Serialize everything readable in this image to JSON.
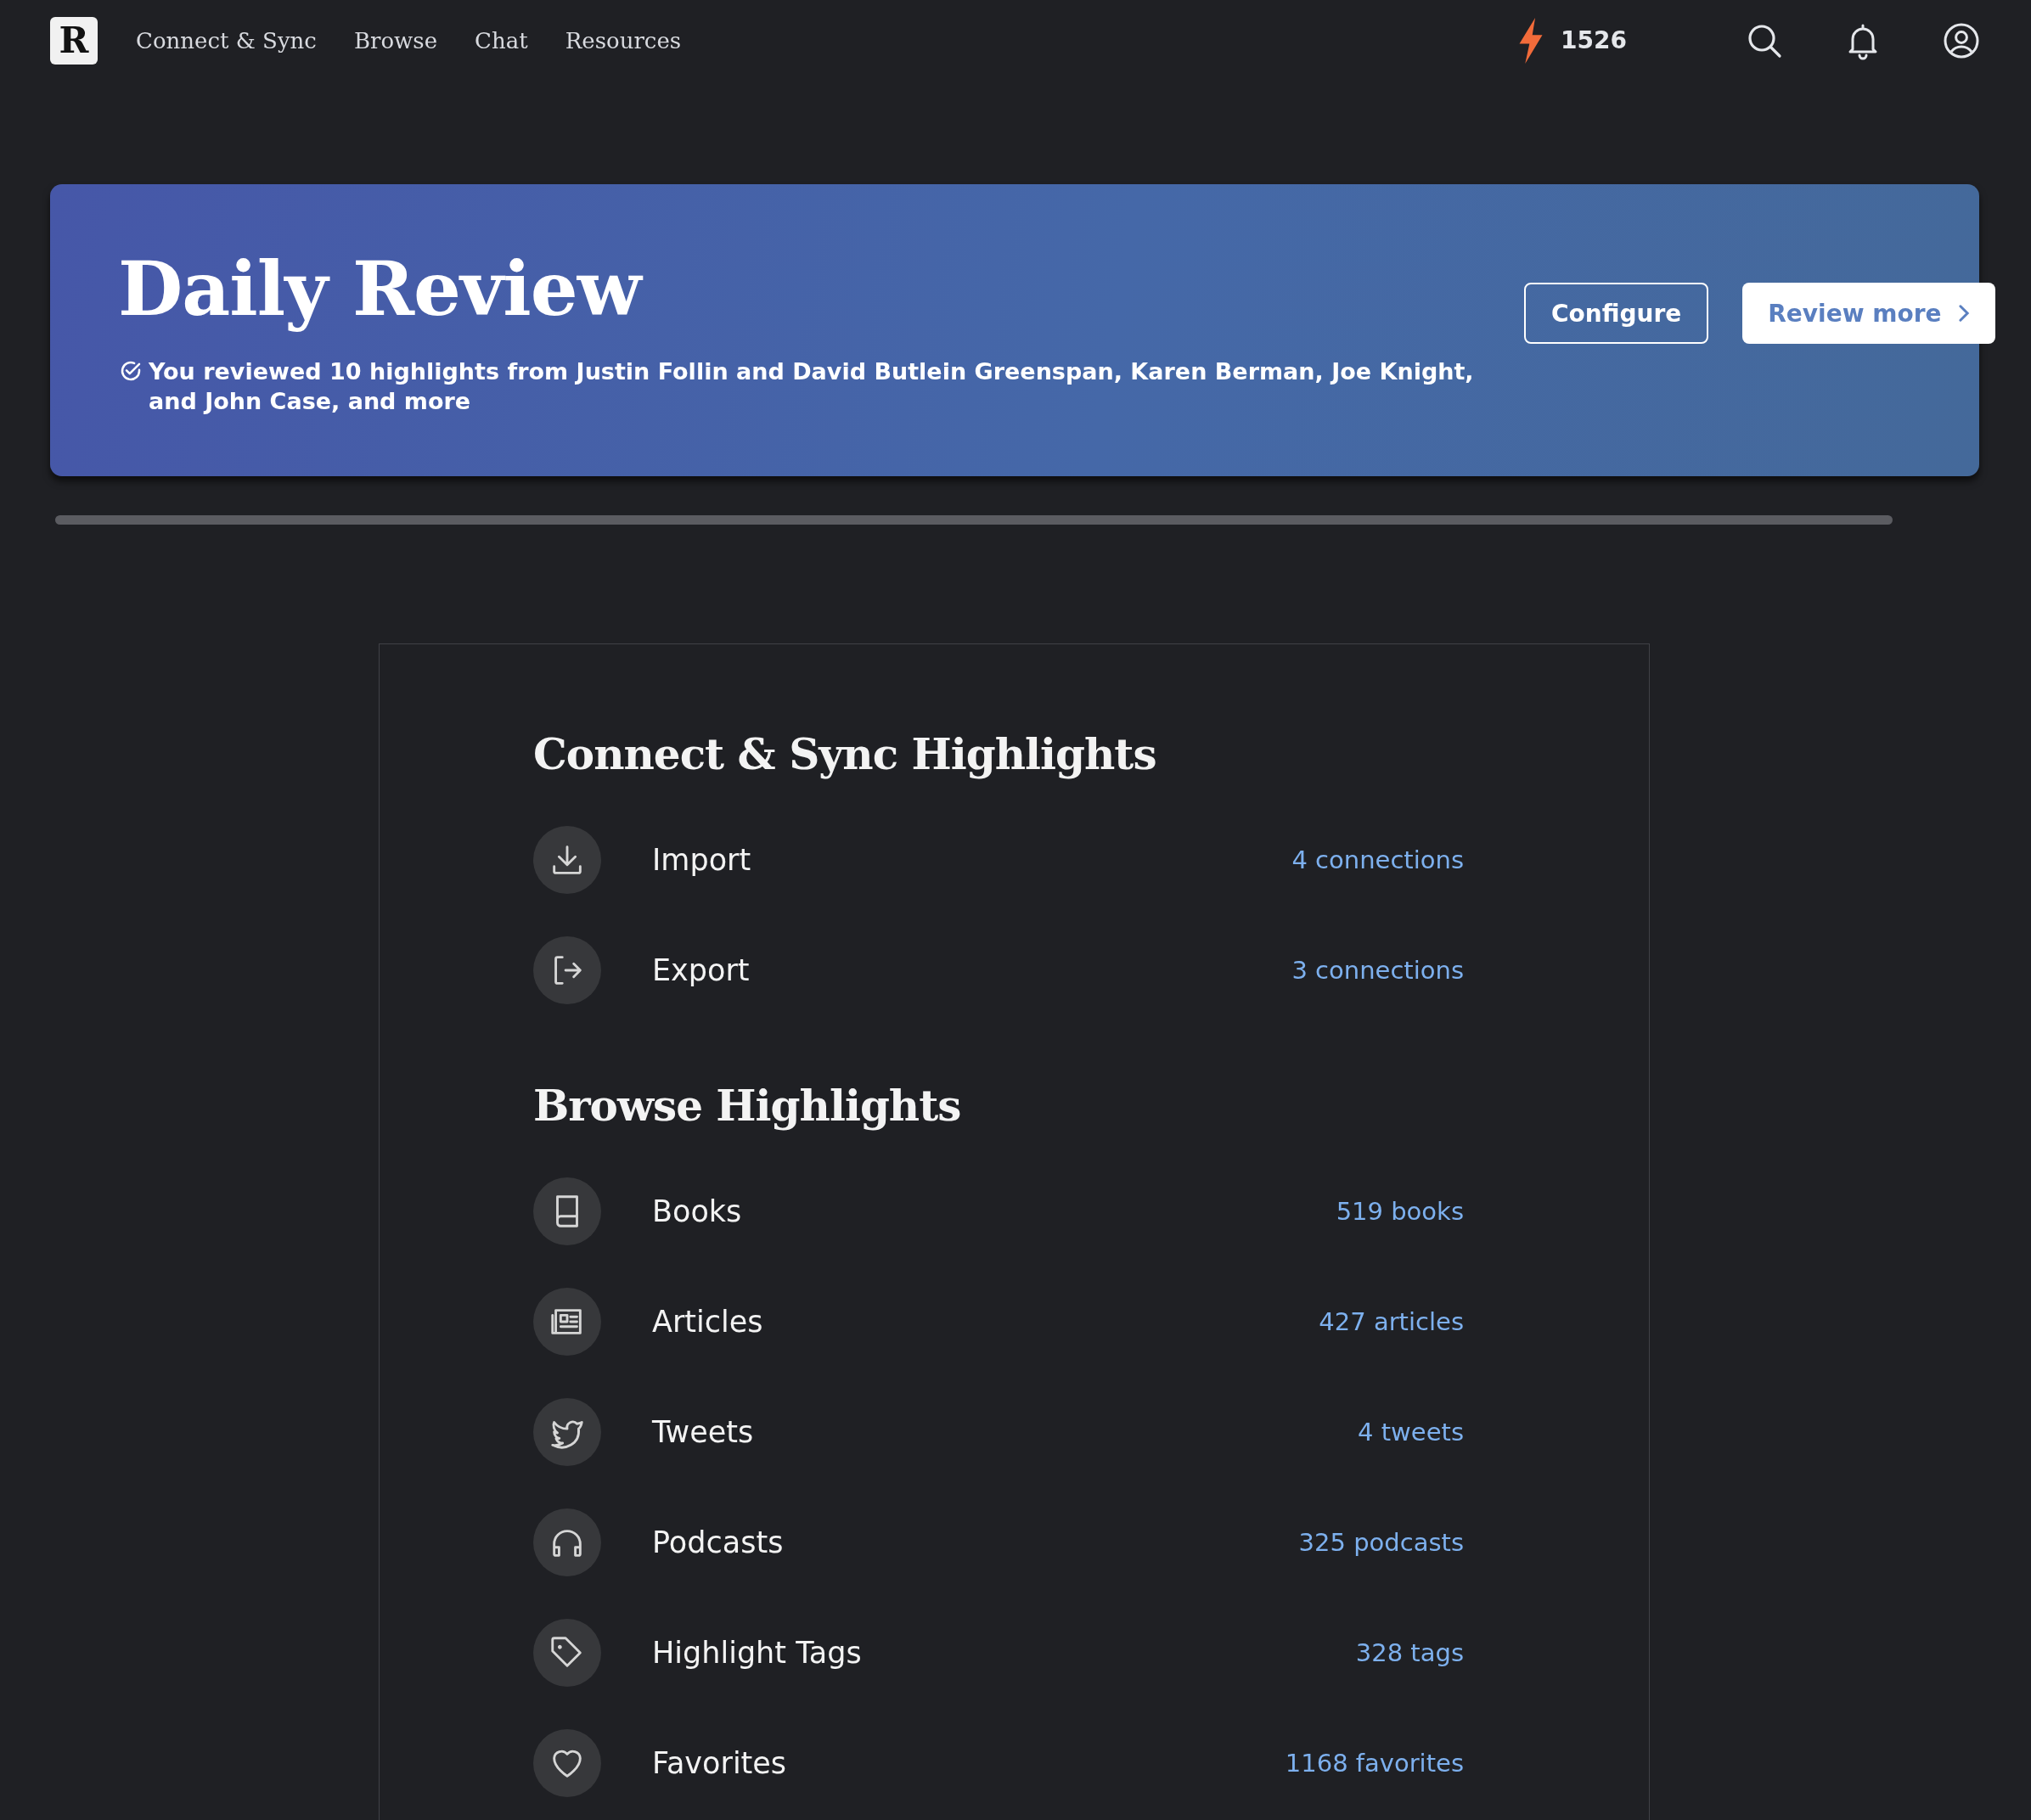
{
  "nav": {
    "logo": "R",
    "links": [
      "Connect & Sync",
      "Browse",
      "Chat",
      "Resources"
    ],
    "streak": "1526"
  },
  "banner": {
    "title": "Daily Review",
    "summary": "You reviewed 10 highlights from Justin Follin and David Butlein Greenspan, Karen Berman, Joe Knight, and John Case, and more",
    "buttons": [
      "Configure",
      "Review more"
    ]
  },
  "sections": [
    {
      "title": "Connect & Sync Highlights",
      "rows": [
        {
          "label": "Import",
          "count": "4 connections"
        },
        {
          "label": "Export",
          "count": "3 connections"
        }
      ]
    },
    {
      "title": "Browse Highlights",
      "rows": [
        {
          "label": "Books",
          "count": "519 books"
        },
        {
          "label": "Articles",
          "count": "427 articles"
        },
        {
          "label": "Tweets",
          "count": "4 tweets"
        },
        {
          "label": "Podcasts",
          "count": "325 podcasts"
        },
        {
          "label": "Highlight Tags",
          "count": "328 tags"
        },
        {
          "label": "Favorites",
          "count": "1168 favorites"
        }
      ]
    }
  ]
}
